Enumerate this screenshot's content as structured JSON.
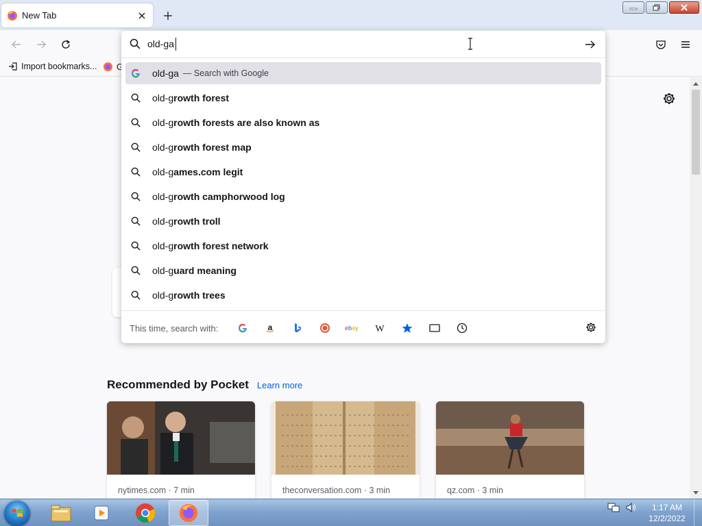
{
  "browser": {
    "tab": {
      "title": "New Tab",
      "favicon": "firefox-icon"
    },
    "window_controls": [
      "minimize-icon",
      "restore-icon",
      "close-icon"
    ]
  },
  "toolbar": {
    "back": "back-arrow-icon",
    "forward": "forward-arrow-icon",
    "reload": "reload-icon",
    "pocket": "pocket-icon",
    "menu": "hamburger-menu-icon"
  },
  "bookmarks": {
    "import_label": "Import bookmarks...",
    "next_item_initial": "G"
  },
  "urlbar": {
    "value": "old-ga",
    "go": "arrow-right-icon"
  },
  "suggestions": {
    "first": {
      "typed": "old-ga",
      "action": "— Search with Google"
    },
    "items": [
      {
        "typed": "old-g",
        "completion": "rowth forest"
      },
      {
        "typed": "old-g",
        "completion": "rowth forests are also known as"
      },
      {
        "typed": "old-g",
        "completion": "rowth forest map"
      },
      {
        "typed": "old-g",
        "completion": "ames.com legit"
      },
      {
        "typed": "old-g",
        "completion": "rowth camphorwood log"
      },
      {
        "typed": "old-g",
        "completion": "rowth troll"
      },
      {
        "typed": "old-g",
        "completion": "rowth forest network"
      },
      {
        "typed": "old-g",
        "completion": "uard meaning"
      },
      {
        "typed": "old-g",
        "completion": "rowth trees"
      }
    ]
  },
  "one_off": {
    "label": "This time, search with:",
    "ebay_text": "ebay",
    "wiki_text": "W",
    "engines": [
      "google-icon",
      "amazon-icon",
      "bing-icon",
      "duckduckgo-icon",
      "ebay-icon",
      "wikipedia-icon",
      "bookmarks-star-icon",
      "tabs-icon",
      "history-icon"
    ]
  },
  "pocket": {
    "title": "Recommended by Pocket",
    "learn_more": "Learn more",
    "cards": [
      {
        "source": "nytimes.com · 7 min"
      },
      {
        "source": "theconversation.com · 3 min"
      },
      {
        "source": "qz.com · 3 min"
      }
    ]
  },
  "taskbar": {
    "time": "1:17 AM",
    "date": "12/2/2022",
    "apps": [
      "windows-explorer-icon",
      "media-player-icon",
      "chrome-icon",
      "firefox-icon"
    ]
  },
  "colors": {
    "accent": "#0061e0",
    "highlight": "#e0e0e6",
    "taskbar": "#7fa4cf"
  }
}
